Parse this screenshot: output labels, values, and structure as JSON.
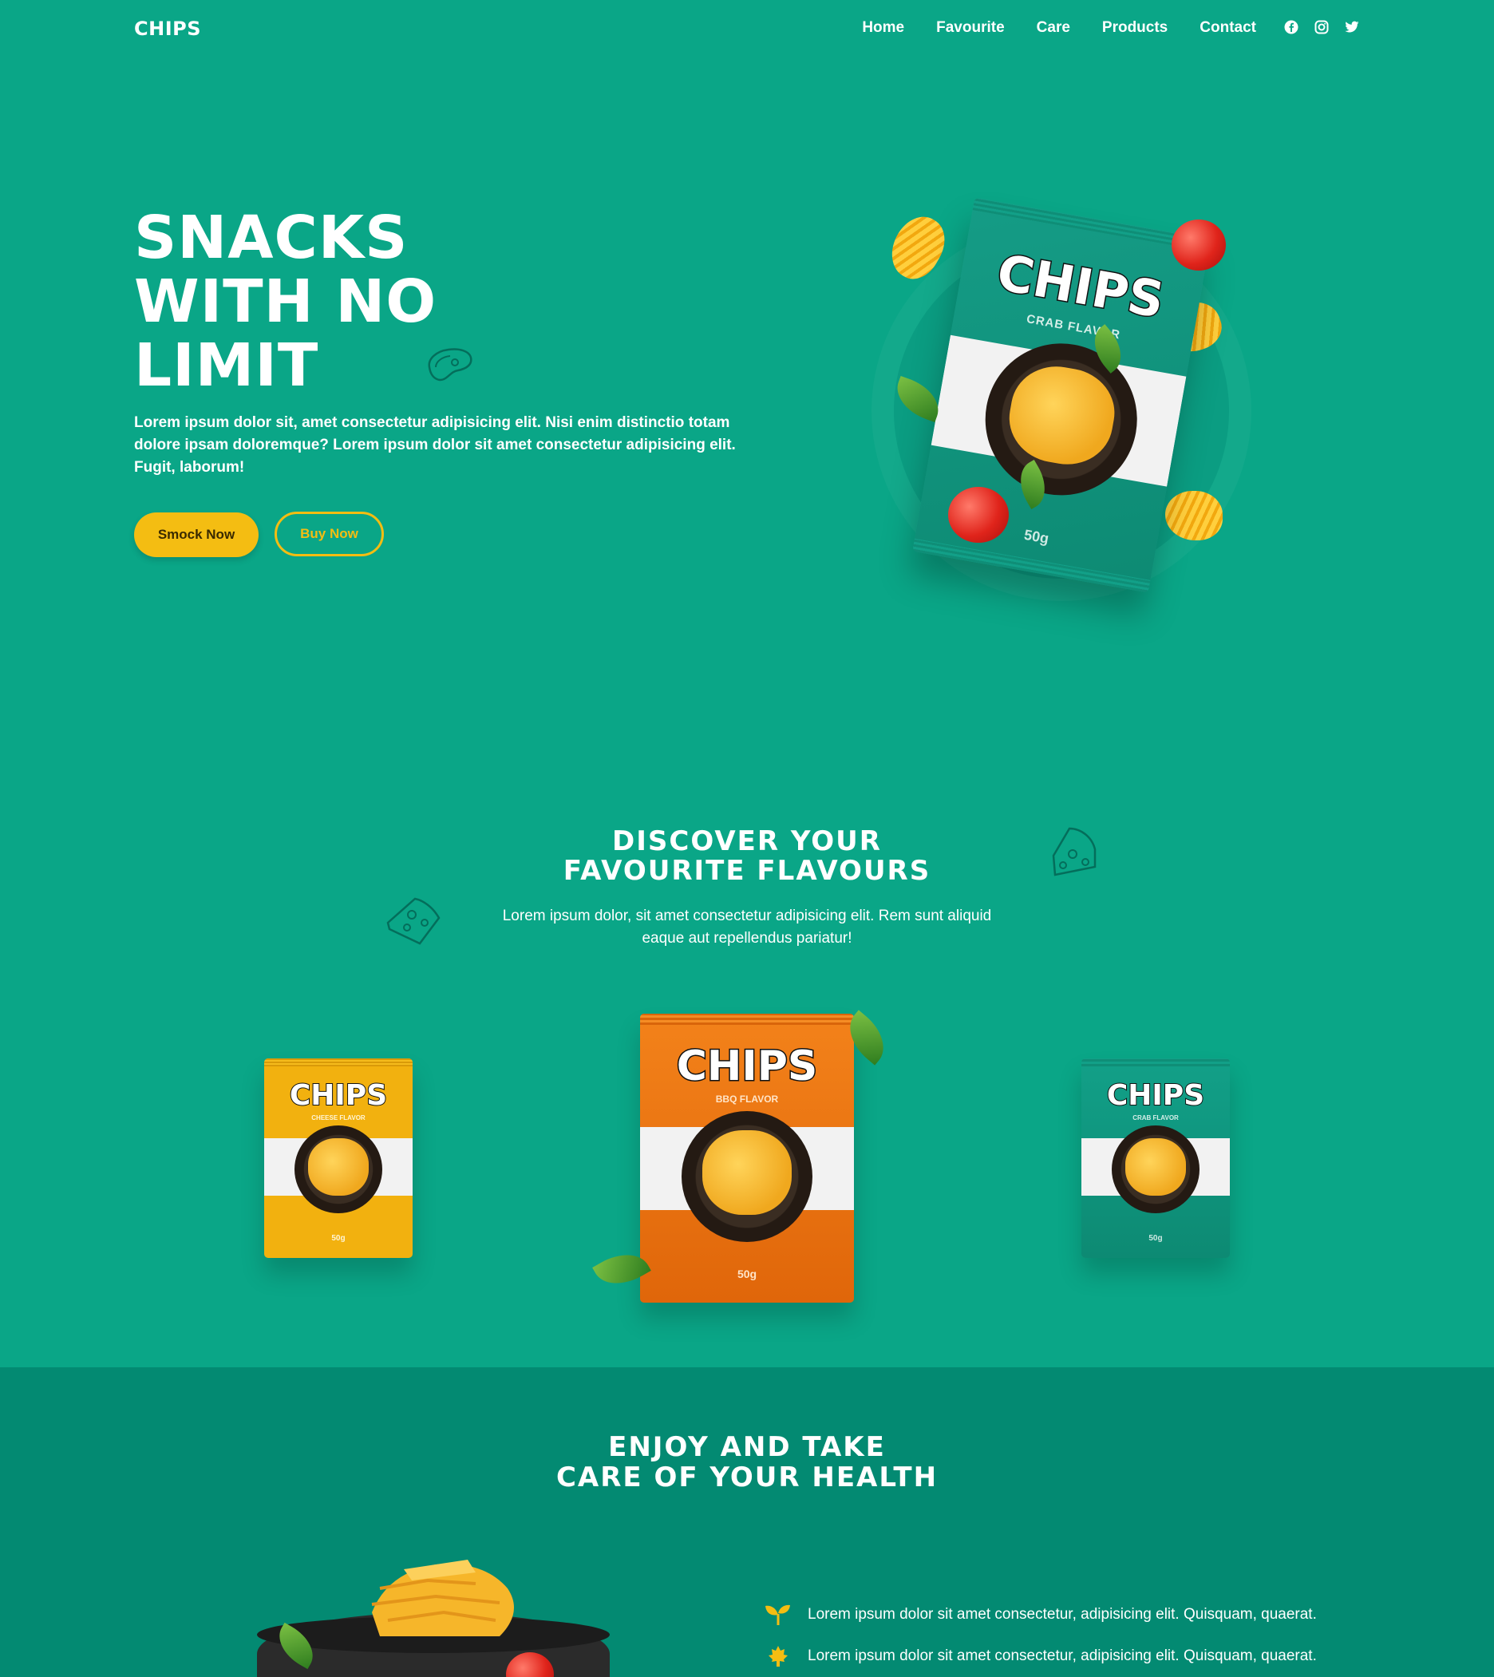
{
  "nav": {
    "logo": "CHIPS",
    "links": [
      "Home",
      "Favourite",
      "Care",
      "Products",
      "Contact"
    ],
    "socials": [
      "facebook-icon",
      "instagram-icon",
      "twitter-icon"
    ]
  },
  "hero": {
    "title_lines": [
      "SNACKS",
      "WITH NO",
      "LIMIT"
    ],
    "text": "Lorem ipsum dolor sit, amet consectetur adipisicing elit. Nisi enim distinctio totam dolore ipsam doloremque? Lorem ipsum dolor sit amet consectetur adipisicing elit. Fugit, laborum!",
    "primary_button": "Smock Now",
    "secondary_button": "Buy Now",
    "bag": {
      "logo": "CHIPS",
      "flavor": "CRAB FLAVOR",
      "weight": "50g"
    }
  },
  "discover": {
    "title_lines": [
      "DISCOVER YOUR",
      "FAVOURITE FLAVOURS"
    ],
    "text": "Lorem ipsum dolor, sit amet consectetur adipisicing elit. Rem sunt aliquid eaque aut repellendus pariatur!",
    "products": [
      {
        "logo": "CHIPS",
        "flavor": "CHEESE FLAVOR",
        "weight": "50g",
        "color": "#f2b10f"
      },
      {
        "logo": "CHIPS",
        "flavor": "BBQ FLAVOR",
        "weight": "50g",
        "color": "#f07a10"
      },
      {
        "logo": "CHIPS",
        "flavor": "CRAB FLAVOR",
        "weight": "50g",
        "color": "#119a83"
      }
    ]
  },
  "health": {
    "title_lines": [
      "ENJOY AND TAKE",
      "CARE OF YOUR HEALTH"
    ],
    "features": [
      {
        "icon": "sprout-icon",
        "text": "Lorem ipsum dolor sit amet consectetur, adipisicing elit. Quisquam, quaerat."
      },
      {
        "icon": "maple-leaf-icon",
        "text": "Lorem ipsum dolor sit amet consectetur, adipisicing elit. Quisquam, quaerat."
      }
    ]
  },
  "colors": {
    "background": "#0aa687",
    "accent": "#f4bd12",
    "section_dark": "#038a72"
  }
}
